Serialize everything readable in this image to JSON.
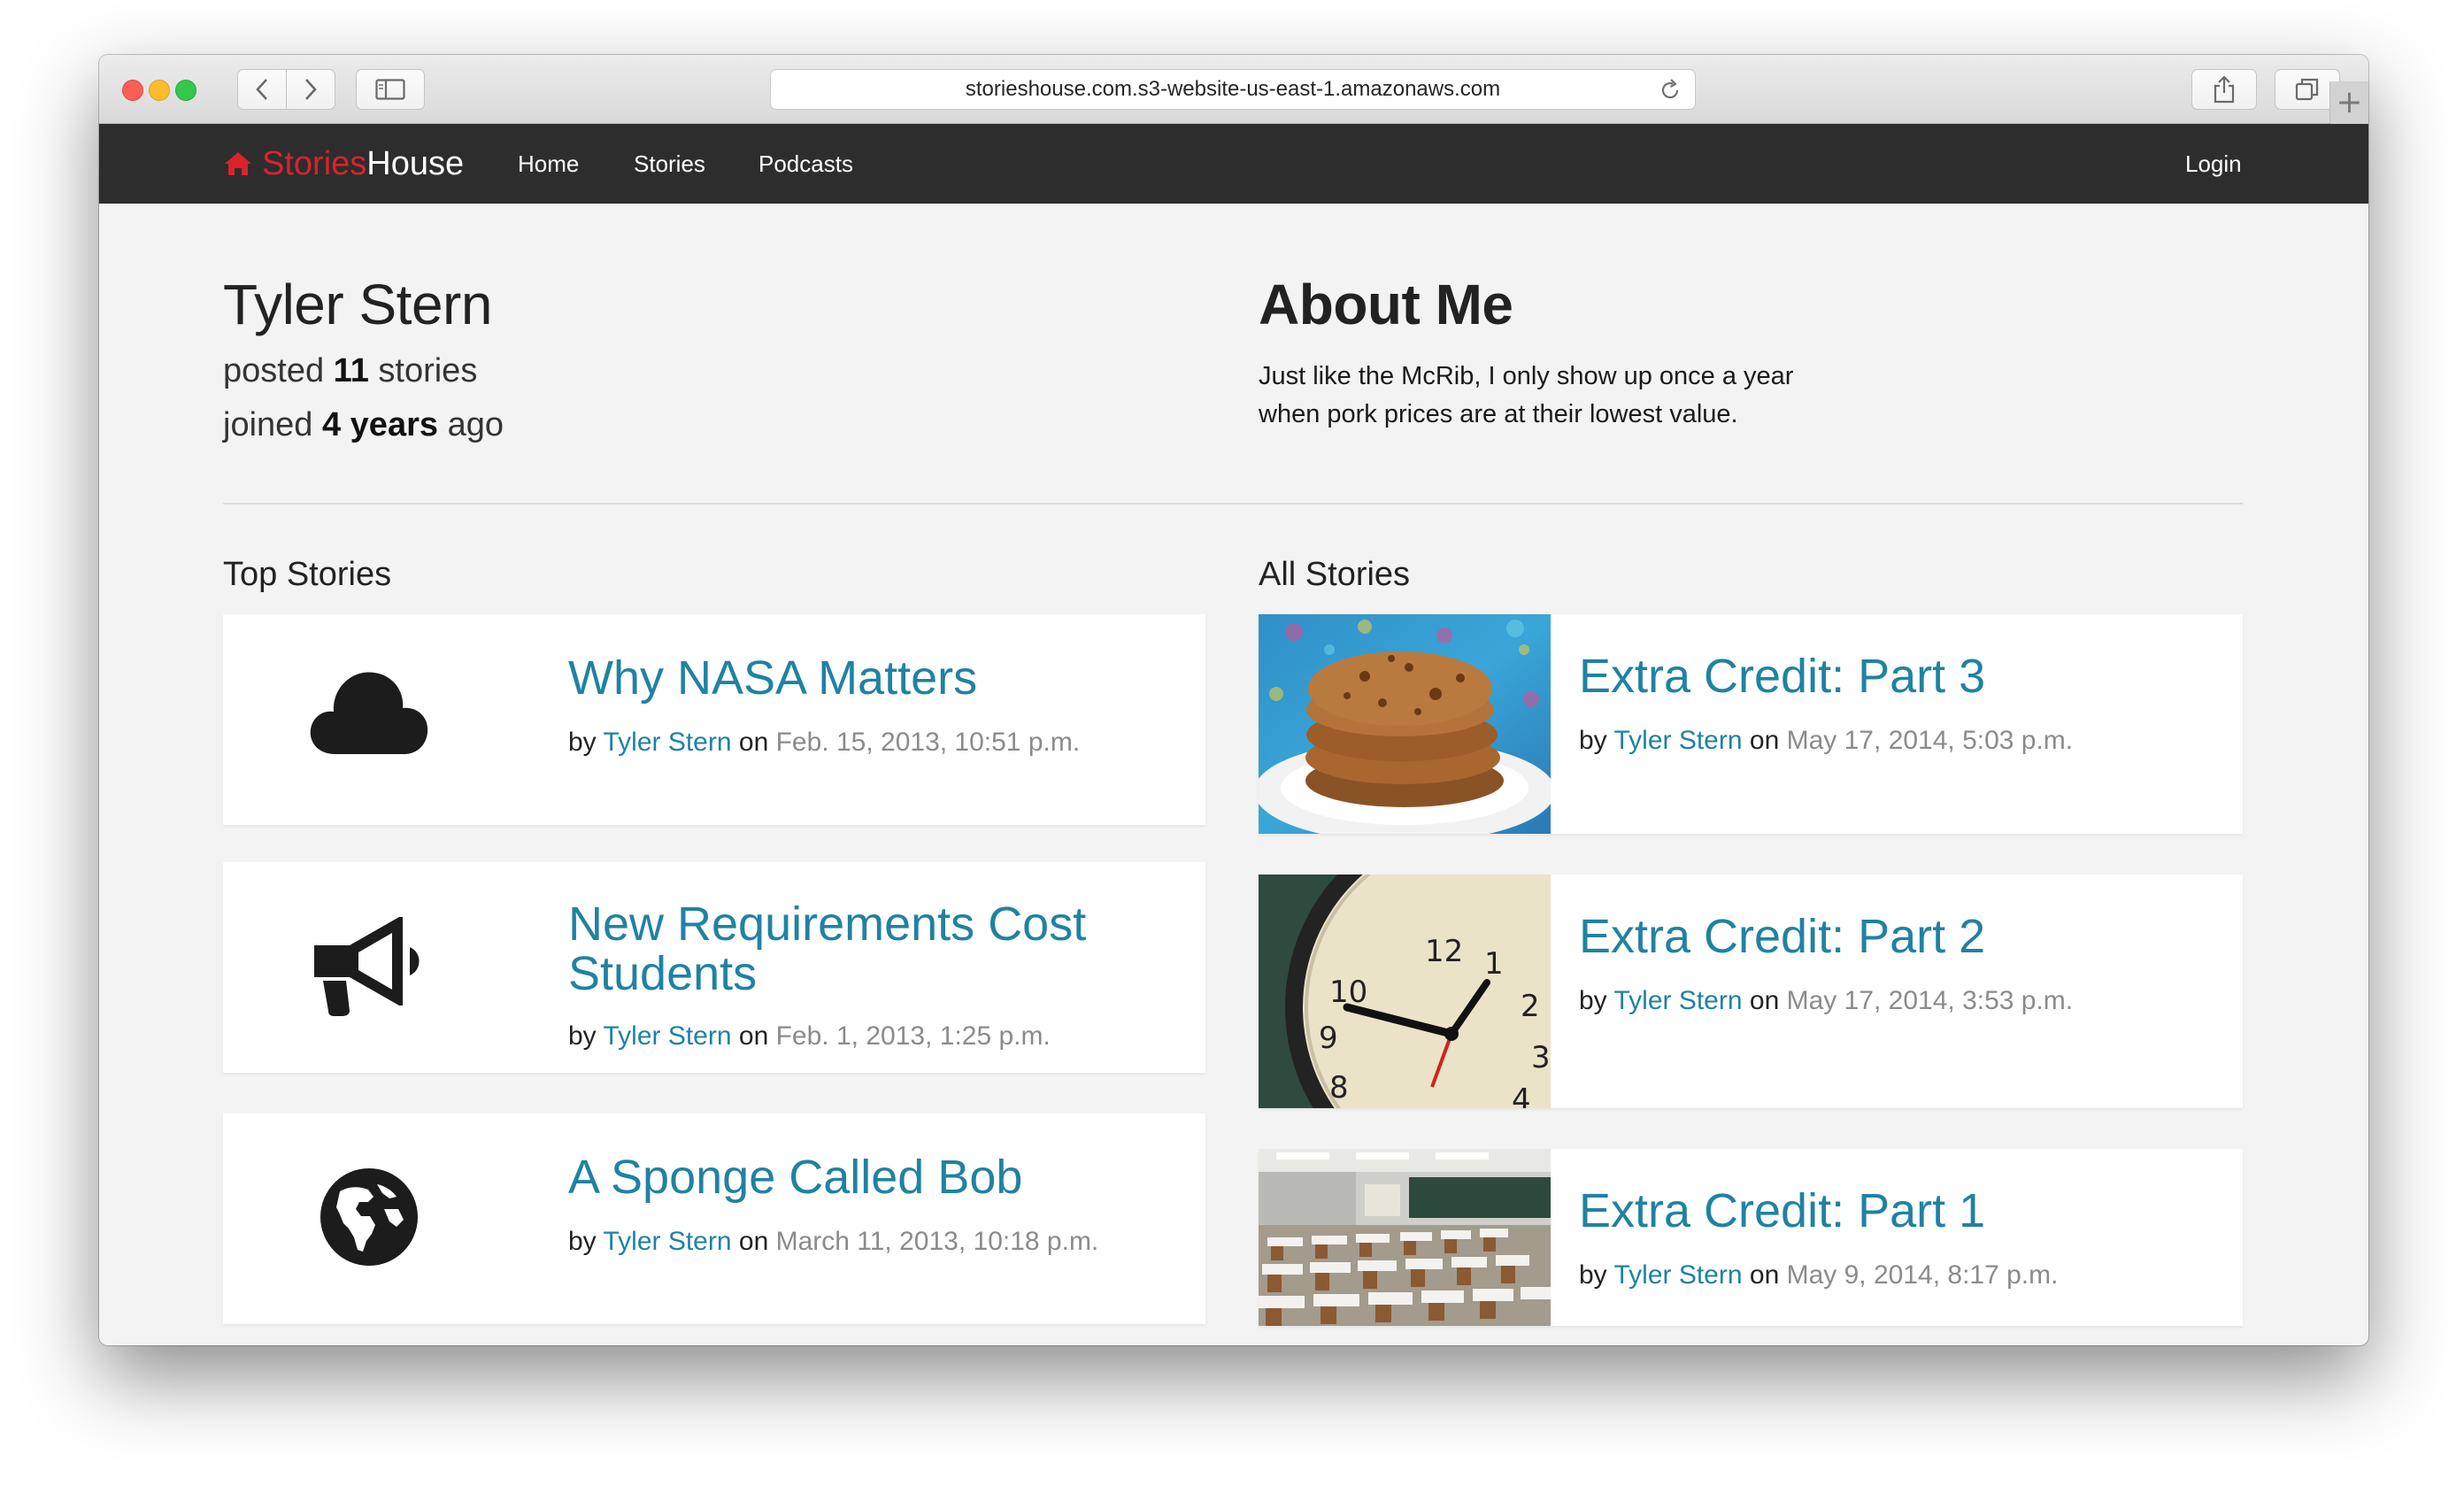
{
  "browser": {
    "url": "storieshouse.com.s3-website-us-east-1.amazonaws.com",
    "plus_label": "+"
  },
  "nav": {
    "brand_part1": "Stories",
    "brand_part2": "House",
    "links": [
      "Home",
      "Stories",
      "Podcasts"
    ],
    "login": "Login",
    "colors": {
      "brand_red": "#d9232e",
      "bar": "#2d2d2d"
    }
  },
  "profile": {
    "name": "Tyler Stern",
    "posted_prefix": "posted",
    "posted_count": "11",
    "posted_suffix": "stories",
    "joined_prefix": "joined",
    "joined_value": "4 years",
    "joined_suffix": "ago",
    "about_title": "About Me",
    "about_line1": "Just like the McRib, I only show up once a year",
    "about_line2": "when pork prices are at their lowest value."
  },
  "top_stories": {
    "heading": "Top Stories",
    "items": [
      {
        "title": "Why NASA Matters",
        "by": "by",
        "author": "Tyler Stern",
        "on": "on",
        "date": "Feb. 15, 2013, 10:51 p.m.",
        "icon": "cloud-icon"
      },
      {
        "title_line1": "New Requirements Cost",
        "title_line2": "Students",
        "by": "by",
        "author": "Tyler Stern",
        "on": "on",
        "date": "Feb. 1, 2013, 1:25 p.m.",
        "icon": "megaphone-icon"
      },
      {
        "title": "A Sponge Called Bob",
        "by": "by",
        "author": "Tyler Stern",
        "on": "on",
        "date": "March 11, 2013, 10:18 p.m.",
        "icon": "globe-icon"
      }
    ]
  },
  "all_stories": {
    "heading": "All Stories",
    "items": [
      {
        "title": "Extra Credit: Part 3",
        "by": "by",
        "author": "Tyler Stern",
        "on": "on",
        "date": "May 17, 2014, 5:03 p.m.",
        "image": "cookies-photo"
      },
      {
        "title": "Extra Credit: Part 2",
        "by": "by",
        "author": "Tyler Stern",
        "on": "on",
        "date": "May 17, 2014, 3:53 p.m.",
        "image": "clock-photo",
        "clock_numbers": [
          "12",
          "1",
          "2",
          "3",
          "4",
          "8",
          "9",
          "10"
        ]
      },
      {
        "title": "Extra Credit: Part 1",
        "by": "by",
        "author": "Tyler Stern",
        "on": "on",
        "date": "May 9, 2014, 8:17 p.m.",
        "image": "classroom-photo"
      }
    ]
  }
}
